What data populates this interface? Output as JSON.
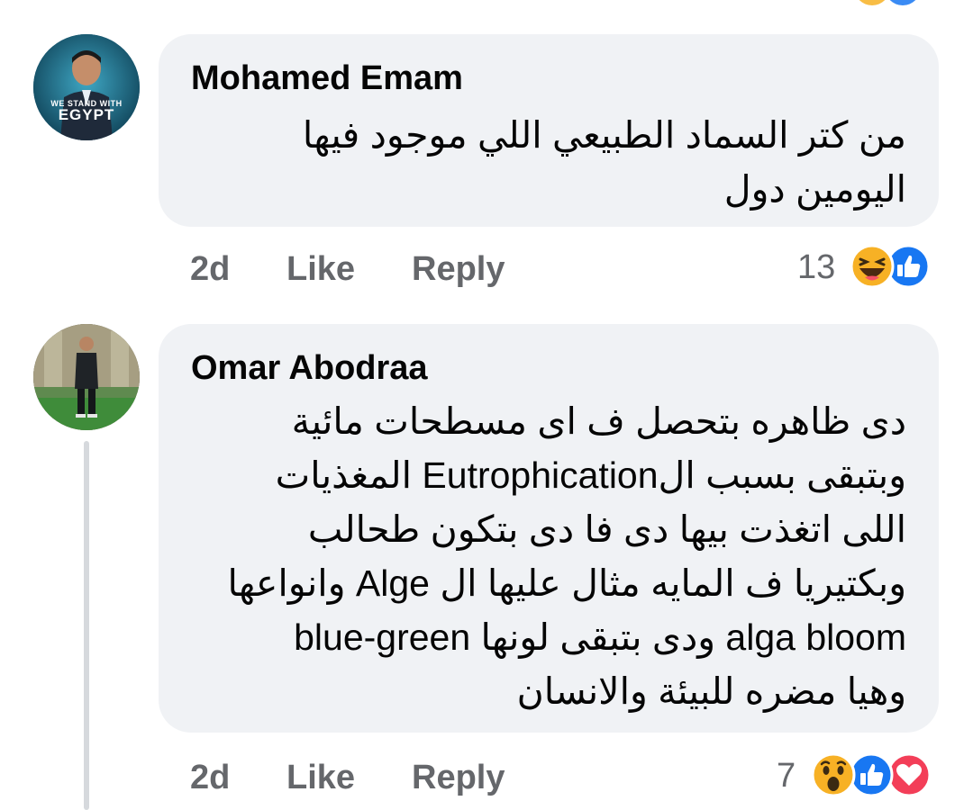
{
  "comments": [
    {
      "author": "Mohamed Emam",
      "avatar_overlay": [
        "WE STAND WITH",
        "EGYPT"
      ],
      "lines": [
        "من كتر السماد الطبيعي اللي موجود فيها",
        "اليومين دول"
      ],
      "time": "2d",
      "like_label": "Like",
      "reply_label": "Reply",
      "reaction_count": "13",
      "reactions": [
        "haha-icon",
        "like-icon"
      ]
    },
    {
      "author": "Omar Abodraa",
      "lines": [
        "دى ظاهره بتحصل ف اى مسطحات مائية",
        "وبتبقى بسبب الEutrophication  المغذيات",
        "اللى اتغذت بيها دى فا دى بتكون طحالب",
        "وبكتيريا ف المايه مثال عليها ال Alge وانواعها",
        "alga bloom  ودى بتبقى لونها blue-green",
        "وهيا  مضره للبيئة والانسان"
      ],
      "time": "2d",
      "like_label": "Like",
      "reply_label": "Reply",
      "reaction_count": "7",
      "reactions": [
        "wow-icon",
        "like-icon",
        "love-icon"
      ]
    }
  ],
  "colors": {
    "bubble": "#f0f2f5",
    "meta_text": "#65676b",
    "like_blue": "#1877f2",
    "love_red": "#f33e58",
    "emoji_yellow": "#f7b125"
  }
}
